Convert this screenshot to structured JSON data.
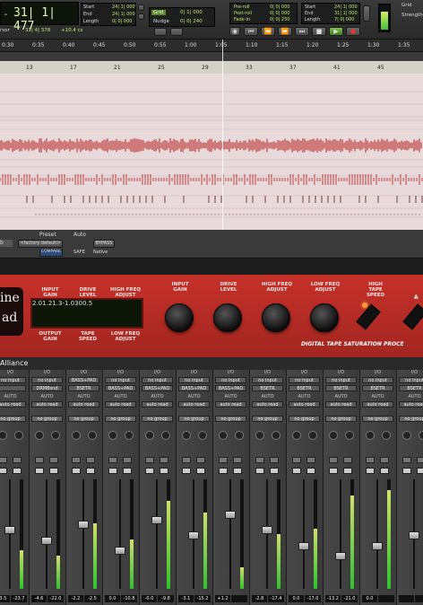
{
  "transport": {
    "counter": "31| 1| 477",
    "counter_prefix": "-",
    "sub_label": "rsor",
    "sub_value": "32| 4| 378",
    "sub_value2": "+10.4 cs",
    "start_label": "Start",
    "end_label": "End",
    "length_label": "Length",
    "start_value": "24| 1| 000",
    "end_value": "24| 1| 000",
    "length_value": "0| 0| 000",
    "grid_label": "Grid",
    "nudge_label": "Nudge",
    "grid_value": "0| 1| 000",
    "nudge_value": "0| 0| 240",
    "preroll_label": "Pre-roll",
    "postroll_label": "Post-roll",
    "fadein_label": "Fade-in",
    "preroll_value": "0| 0| 000",
    "postroll_value": "0| 0| 000",
    "fadein_value": "0| 0| 250",
    "start2_label": "Start",
    "end2_label": "End",
    "length2_label": "Length",
    "start2_value": "24| 1| 000",
    "end2_value": "31| 1| 000",
    "length2_value": "7| 0| 000",
    "right_label1": "Grid",
    "right_label2": "Strength"
  },
  "ruler": {
    "times": [
      "0:30",
      "0:35",
      "0:40",
      "0:45",
      "0:50",
      "0:55",
      "1:00",
      "1:05",
      "1:10",
      "1:15",
      "1:20",
      "1:25",
      "1:30",
      "1:35"
    ],
    "bars": [
      "13",
      "17",
      "21",
      "25",
      "29",
      "33",
      "37",
      "41",
      "45"
    ]
  },
  "plugin_header": {
    "preset_label": "Preset",
    "auto_label": "Auto",
    "preset_value": "<factory default>",
    "compare_label": "COMPARE",
    "bypass_label": "BYPASS",
    "safe_label": "SAFE",
    "native_label": "Native",
    "track_letter": "b"
  },
  "plugin": {
    "brand_line1": "ine",
    "brand_line2": "ad",
    "lcd_labels_top": [
      "INPUT\nGAIN",
      "DRIVE\nLEVEL",
      "HIGH FREQ\nADJUST"
    ],
    "lcd_labels_bottom": [
      "OUTPUT\nGAIN",
      "TAPE\nSPEED",
      "LOW FREQ\nADJUST"
    ],
    "lcd_values_top": [
      "2.0",
      "1.2",
      "1.3"
    ],
    "lcd_values_bottom": [
      "-1.0",
      "30",
      "0.5"
    ],
    "knob_labels": [
      "INPUT\nGAIN",
      "DRIVE\nLEVEL",
      "HIGH FREQ\nADJUST",
      "LOW FREQ\nADJUST",
      "HIGH\nTAPE\nSPEED"
    ],
    "tagline": "DIGITAL TAPE SATURATION PROCE",
    "right_letter": "A"
  },
  "mixer": {
    "title": "Alliance",
    "strips": [
      {
        "io": "I/O",
        "in": "no input",
        "out": "",
        "auto": "AUTO",
        "mode": "auto read",
        "group": "no group",
        "vol": "-23.7",
        "pk": "-3.5"
      },
      {
        "io": "I/O",
        "in": "no input",
        "out": "DRMBsnd",
        "auto": "AUTO",
        "mode": "auto read",
        "group": "no group",
        "vol": "-22.0",
        "pk": "-4.6"
      },
      {
        "io": "I/O",
        "in": "BASS+PAD",
        "out": "BSETR",
        "auto": "AUTO",
        "mode": "auto read",
        "group": "no group",
        "vol": "-2.5",
        "pk": "-2.2"
      },
      {
        "io": "I/O",
        "in": "no input",
        "out": "BASS+PAD",
        "auto": "AUTO",
        "mode": "auto read",
        "group": "no group",
        "vol": "-10.8",
        "pk": "0.0"
      },
      {
        "io": "I/O",
        "in": "no input",
        "out": "BASS+PAD",
        "auto": "AUTO",
        "mode": "auto read",
        "group": "no group",
        "vol": "-9.8",
        "pk": "-0.0"
      },
      {
        "io": "I/O",
        "in": "no input",
        "out": "BASS+PAD",
        "auto": "AUTO",
        "mode": "auto read",
        "group": "no group",
        "vol": "-15.2",
        "pk": "-3.1"
      },
      {
        "io": "I/O",
        "in": "no input",
        "out": "BASS+PAD",
        "auto": "AUTO",
        "mode": "auto read",
        "group": "no group",
        "vol": "",
        "pk": "+1.2"
      },
      {
        "io": "I/O",
        "in": "no input",
        "out": "BSETR",
        "auto": "AUTO",
        "mode": "auto read",
        "group": "no group",
        "vol": "-17.4",
        "pk": "-2.8"
      },
      {
        "io": "I/O",
        "in": "no input",
        "out": "BSETR",
        "auto": "AUTO",
        "mode": "auto read",
        "group": "no group",
        "vol": "-17.0",
        "pk": "0.0"
      },
      {
        "io": "I/O",
        "in": "no input",
        "out": "BSETR",
        "auto": "AUTO",
        "mode": "auto read",
        "group": "no group",
        "vol": "-21.0",
        "pk": "-13.2"
      },
      {
        "io": "I/O",
        "in": "no input",
        "out": "BSETR",
        "auto": "AUTO",
        "mode": "auto read",
        "group": "no group",
        "vol": "",
        "pk": "0.0"
      },
      {
        "io": "I/O",
        "in": "no input",
        "out": "BSETR",
        "auto": "AUTO",
        "mode": "auto read",
        "group": "no group",
        "vol": "",
        "pk": ""
      }
    ],
    "fader_levels": [
      0.55,
      0.45,
      0.6,
      0.35,
      0.65,
      0.5,
      0.7,
      0.55,
      0.4,
      0.3,
      0.4,
      0.5
    ],
    "meter_levels": [
      0.35,
      0.3,
      0.6,
      0.45,
      0.8,
      0.7,
      0.2,
      0.5,
      0.55,
      0.85,
      0.9,
      0.4
    ]
  }
}
